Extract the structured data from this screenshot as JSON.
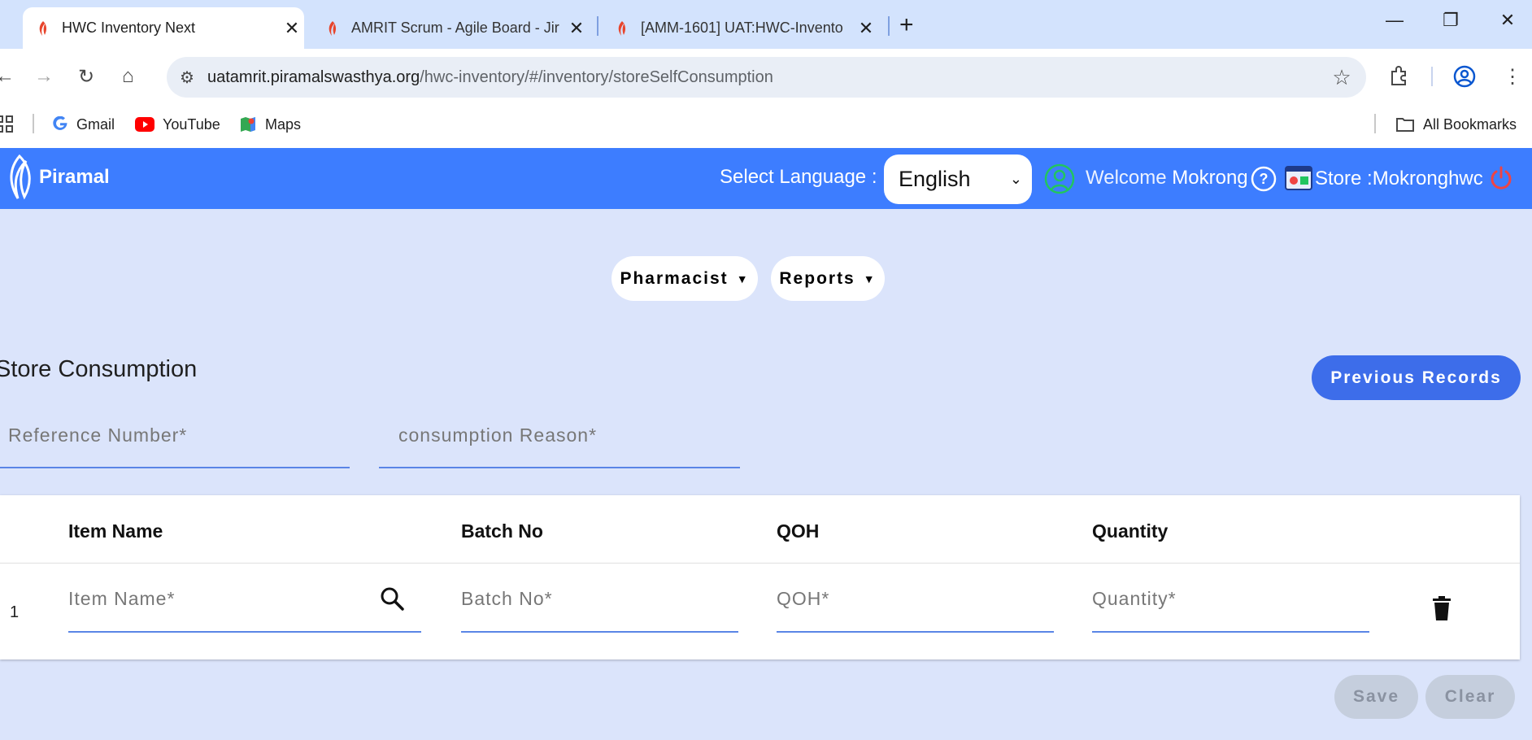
{
  "browser": {
    "tabs": [
      {
        "title": "HWC Inventory Next",
        "active": true
      },
      {
        "title": "AMRIT Scrum - Agile Board - Jir",
        "active": false
      },
      {
        "title": "[AMM-1601] UAT:HWC-Invento",
        "active": false
      }
    ],
    "url_host": "uatamrit.piramalswasthya.org",
    "url_path": "/hwc-inventory/#/inventory/storeSelfConsumption",
    "bookmarks": [
      {
        "label": "Gmail",
        "icon": "gmail-icon"
      },
      {
        "label": "YouTube",
        "icon": "youtube-icon"
      },
      {
        "label": "Maps",
        "icon": "maps-icon"
      }
    ],
    "all_bookmarks": "All Bookmarks"
  },
  "header": {
    "logo_text": "Piramal",
    "language_label": "Select Language :",
    "language_value": "English",
    "welcome_label": "Welcome",
    "user_name": "Mokrong",
    "store_label": "Store :",
    "store_name": "Mokronghwc"
  },
  "menu": {
    "pharmacist": "Pharmacist",
    "reports": "Reports"
  },
  "page": {
    "title": "Store Consumption",
    "previous_records": "Previous Records",
    "reference_placeholder": "Reference Number*",
    "reason_placeholder": "consumption Reason*"
  },
  "table": {
    "headers": [
      "Item Name",
      "Batch No",
      "QOH",
      "Quantity"
    ],
    "rows": [
      {
        "index": "1",
        "item_placeholder": "Item Name*",
        "batch_placeholder": "Batch No*",
        "qoh_placeholder": "QOH*",
        "quantity_placeholder": "Quantity*"
      }
    ]
  },
  "actions": {
    "save": "Save",
    "clear": "Clear"
  },
  "colors": {
    "header_blue": "#3d7dff",
    "primary_button": "#3d6dea",
    "page_bg": "#dbe4fb",
    "disabled_button": "#c5cedd"
  }
}
